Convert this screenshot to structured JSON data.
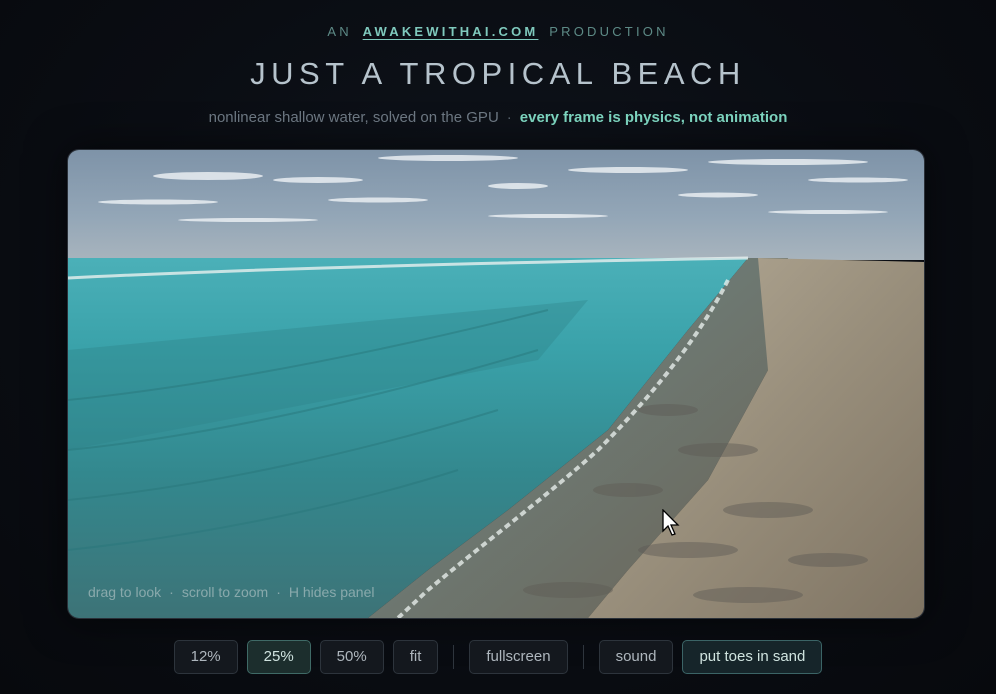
{
  "header": {
    "kicker_prefix": "AN",
    "brand_link": "AWAKEWITHAI.COM",
    "kicker_suffix": "PRODUCTION",
    "title": "JUST A TROPICAL BEACH",
    "subtitle": "nonlinear shallow water, solved on the GPU",
    "separator": "·",
    "subtitle_emphasis": "every frame is physics, not animation"
  },
  "viewport": {
    "hints": [
      "drag to look",
      "scroll to zoom",
      "H hides panel"
    ],
    "hint_separator": "·"
  },
  "toolbar": {
    "resolution_buttons": [
      {
        "label": "12%",
        "active": false
      },
      {
        "label": "25%",
        "active": true
      },
      {
        "label": "50%",
        "active": false
      },
      {
        "label": "fit",
        "active": false
      }
    ],
    "fullscreen_label": "fullscreen",
    "sound_label": "sound",
    "toes_label": "put toes in sand"
  },
  "colors": {
    "accent": "#7fd9c3",
    "sky": "#8fa4b6",
    "sea": "#3a9fa6",
    "sand": "#a79c88"
  }
}
